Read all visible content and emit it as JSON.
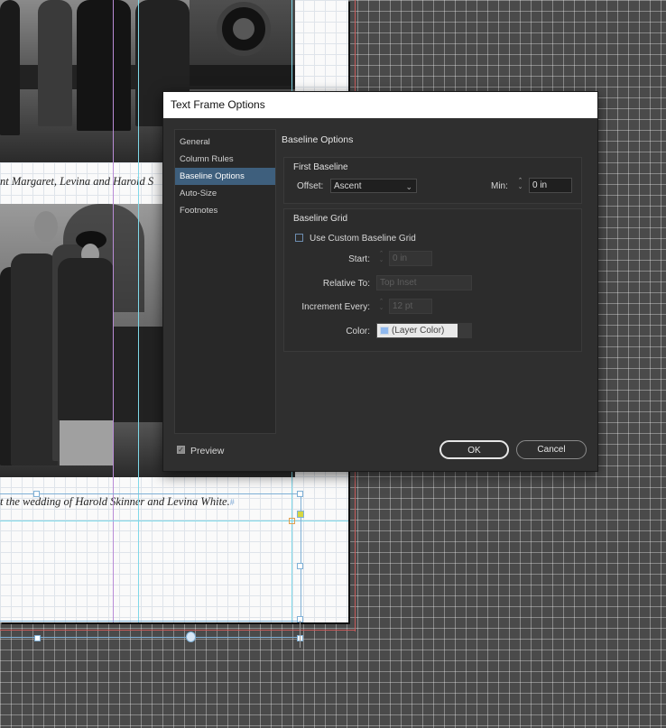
{
  "document": {
    "caption_top": "nt Margaret, Levina and Harold S",
    "caption_bottom": "t the wedding of Harold Skinner and Levina White.",
    "caption_bottom_mark": "#"
  },
  "dialog": {
    "title": "Text Frame Options",
    "nav": [
      {
        "label": "General",
        "selected": false
      },
      {
        "label": "Column Rules",
        "selected": false
      },
      {
        "label": "Baseline Options",
        "selected": true
      },
      {
        "label": "Auto-Size",
        "selected": false
      },
      {
        "label": "Footnotes",
        "selected": false
      }
    ],
    "panel_title": "Baseline Options",
    "first_baseline": {
      "title": "First Baseline",
      "offset_label": "Offset:",
      "offset_value": "Ascent",
      "min_label": "Min:",
      "min_value": "0 in"
    },
    "baseline_grid": {
      "title": "Baseline Grid",
      "use_custom_label": "Use Custom Baseline Grid",
      "use_custom_checked": false,
      "start_label": "Start:",
      "start_value": "0 in",
      "relative_label": "Relative To:",
      "relative_value": "Top Inset",
      "increment_label": "Increment Every:",
      "increment_value": "12 pt",
      "color_label": "Color:",
      "color_value": "(Layer Color)",
      "color_swatch": "#8fb8ee"
    },
    "preview_label": "Preview",
    "preview_checked": true,
    "ok_label": "OK",
    "cancel_label": "Cancel"
  },
  "colors": {
    "pasteboard": "#4a4a4a",
    "dialog_bg": "#2f2f2f",
    "nav_selected": "#3e5f7d",
    "guide_cyan": "#7fd8e8",
    "guide_purple": "#b98cd6",
    "bleed_red": "#c85a5a"
  }
}
